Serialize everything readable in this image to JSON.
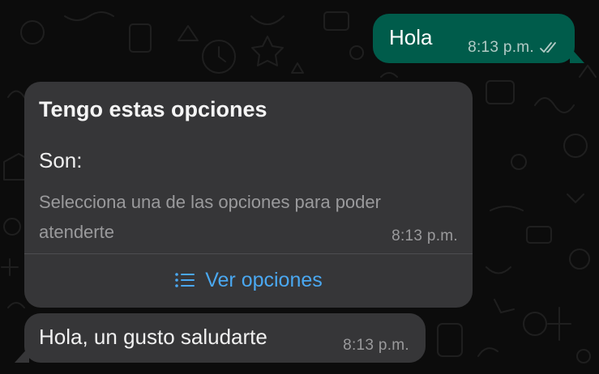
{
  "messages": [
    {
      "direction": "outgoing",
      "text": "Hola",
      "time": "8:13 p.m.",
      "status_icon": "double-check-icon"
    },
    {
      "direction": "incoming",
      "type": "list-card",
      "title": "Tengo estas opciones",
      "body": "Son:",
      "footer": "Selecciona una de las opciones para poder atenderte",
      "time": "8:13 p.m.",
      "action_label": "Ver opciones",
      "action_icon": "list-icon"
    },
    {
      "direction": "incoming",
      "text": "Hola, un gusto saludarte",
      "time": "8:13 p.m."
    }
  ],
  "colors": {
    "wallpaper": "#0c0c0c",
    "outgoing_bubble": "#005c4b",
    "incoming_bubble": "#363638",
    "link_accent": "#4aa8f1",
    "meta_text": "#9a9a9c"
  }
}
